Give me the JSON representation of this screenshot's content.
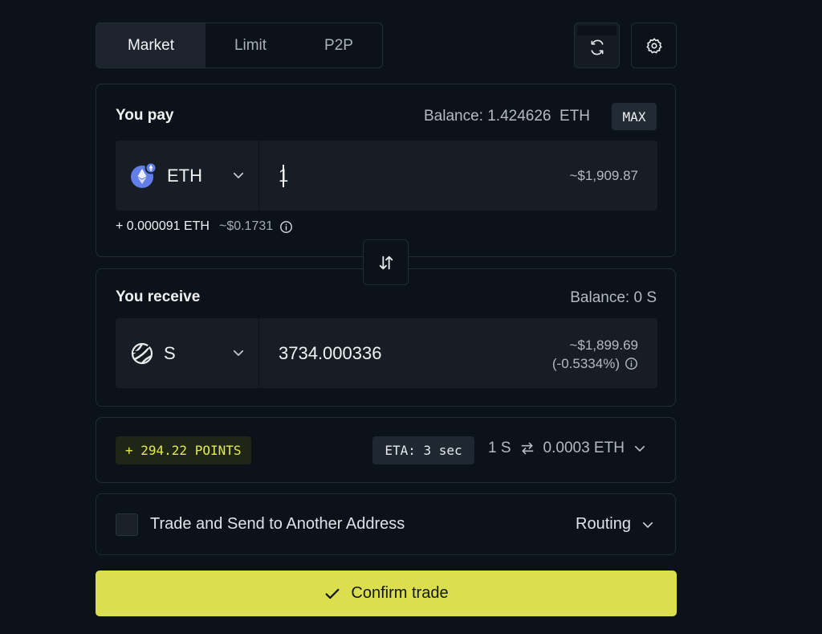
{
  "tabs": [
    {
      "label": "Market",
      "active": true
    },
    {
      "label": "Limit",
      "active": false
    },
    {
      "label": "P2P",
      "active": false
    }
  ],
  "toolbar": {
    "refresh_icon": "refresh-icon",
    "settings_icon": "gear-icon"
  },
  "pay": {
    "label": "You pay",
    "balance_text": "Balance: 1.424626",
    "balance_unit": "ETH",
    "max_label": "MAX",
    "token": "ETH",
    "amount": "1",
    "usd_value": "~$1,909.87",
    "fee_eth": "+ 0.000091 ETH",
    "fee_usd": "~$0.1731"
  },
  "receive": {
    "label": "You receive",
    "balance_text": "Balance: 0 S",
    "token": "S",
    "amount": "3734.000336",
    "usd_value": "~$1,899.69",
    "price_impact": "(-0.5334%)"
  },
  "quote": {
    "points": "+ 294.22 POINTS",
    "eta": "ETA: 3 sec",
    "rate_left": "1 S",
    "rate_right": "0.0003 ETH"
  },
  "options": {
    "send_label": "Trade and Send to Another Address",
    "routing_label": "Routing"
  },
  "confirm": {
    "label": "Confirm trade"
  },
  "colors": {
    "accent": "#dbdf4d",
    "background": "#0b121a",
    "panel": "#161d25",
    "eth": "#627eea"
  }
}
